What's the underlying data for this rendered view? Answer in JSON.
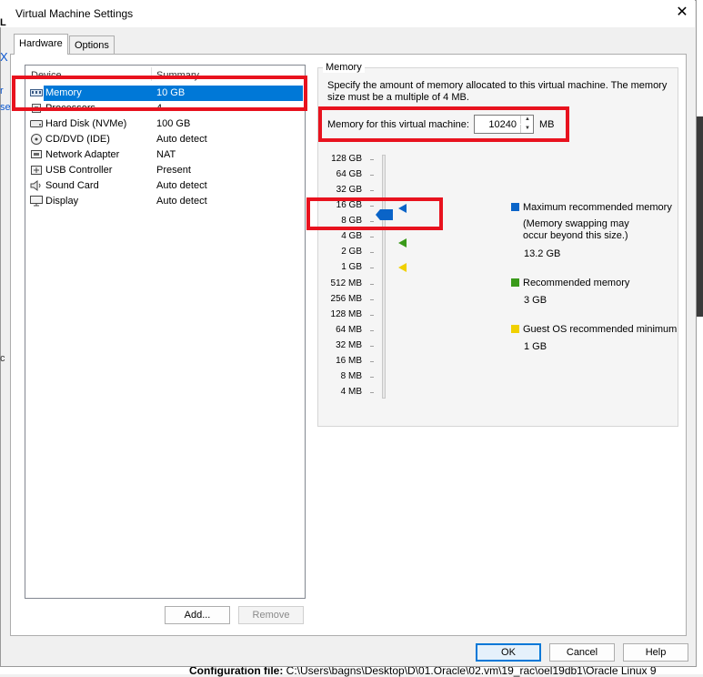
{
  "window": {
    "title": "Virtual Machine Settings"
  },
  "tabs": [
    {
      "label": "Hardware",
      "active": true
    },
    {
      "label": "Options",
      "active": false
    }
  ],
  "device_list": {
    "columns": {
      "device": "Device",
      "summary": "Summary"
    },
    "items": [
      {
        "icon": "memory-icon",
        "name": "Memory",
        "summary": "10 GB",
        "selected": true
      },
      {
        "icon": "processor-icon",
        "name": "Processors",
        "summary": "4",
        "selected": false
      },
      {
        "icon": "hard-disk-icon",
        "name": "Hard Disk (NVMe)",
        "summary": "100 GB",
        "selected": false
      },
      {
        "icon": "cd-dvd-icon",
        "name": "CD/DVD (IDE)",
        "summary": "Auto detect",
        "selected": false
      },
      {
        "icon": "network-adapter-icon",
        "name": "Network Adapter",
        "summary": "NAT",
        "selected": false
      },
      {
        "icon": "usb-controller-icon",
        "name": "USB Controller",
        "summary": "Present",
        "selected": false
      },
      {
        "icon": "sound-card-icon",
        "name": "Sound Card",
        "summary": "Auto detect",
        "selected": false
      },
      {
        "icon": "display-icon",
        "name": "Display",
        "summary": "Auto detect",
        "selected": false
      }
    ],
    "add_label": "Add...",
    "remove_label": "Remove"
  },
  "memory": {
    "group_label": "Memory",
    "description": "Specify the amount of memory allocated to this virtual machine. The memory size must be a multiple of 4 MB.",
    "field_label": "Memory for this virtual machine:",
    "value": "10240",
    "unit": "MB",
    "ticks": [
      "128 GB",
      "64 GB",
      "32 GB",
      "16 GB",
      "8 GB",
      "4 GB",
      "2 GB",
      "1 GB",
      "512 MB",
      "256 MB",
      "128 MB",
      "64 MB",
      "32 MB",
      "16 MB",
      "8 MB",
      "4 MB"
    ],
    "legend": {
      "max": {
        "label": "Maximum recommended memory",
        "note": "(Memory swapping may occur beyond this size.)",
        "value": "13.2 GB",
        "color": "#0a64c8"
      },
      "recommended": {
        "label": "Recommended memory",
        "value": "3 GB",
        "color": "#3a9a1a"
      },
      "guest_min": {
        "label": "Guest OS recommended minimum",
        "value": "1 GB",
        "color": "#f0d000"
      }
    },
    "slider_color": "#0a64c8"
  },
  "footer": {
    "ok": "OK",
    "cancel": "Cancel",
    "help": "Help"
  },
  "background": {
    "config_label": "Configuration file:",
    "config_path": "C:\\Users\\bagns\\Desktop\\D\\01.Oracle\\02.vm\\19_rac\\oel19db1\\Oracle Linux 9",
    "frag_l": "L",
    "frag_x": "X",
    "frag_r": "r",
    "frag_se": "se",
    "frag_c": "c"
  }
}
